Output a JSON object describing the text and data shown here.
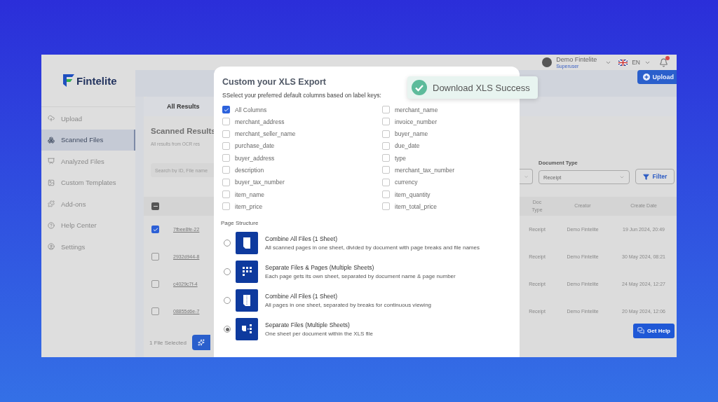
{
  "brand": {
    "name": "Fintelite"
  },
  "sidebar": {
    "items": [
      {
        "label": "Upload",
        "selected": false
      },
      {
        "label": "Scanned Files",
        "selected": true
      },
      {
        "label": "Analyzed Files",
        "selected": false
      },
      {
        "label": "Custom Templates",
        "selected": false
      },
      {
        "label": "Add-ons",
        "selected": false
      },
      {
        "label": "Help Center",
        "selected": false
      },
      {
        "label": "Settings",
        "selected": false
      }
    ]
  },
  "header": {
    "user": {
      "name": "Demo Fintelite",
      "role": "Superuser"
    },
    "language": "EN",
    "upload_button": "Upload"
  },
  "tabs": [
    {
      "label": "All Results",
      "selected": true
    }
  ],
  "page": {
    "title": "Scanned Results",
    "subtitle": "All results from OCR res",
    "search": {
      "placeholder": "Search by ID, File name"
    }
  },
  "filters": {
    "document_type": {
      "label": "Document Type",
      "value": "Receipt"
    },
    "button": "Filter"
  },
  "table": {
    "select_all": {
      "indeterminate": true
    },
    "columns": [
      "Doc Type",
      "Creator",
      "Create Date"
    ],
    "rows": [
      {
        "selected": true,
        "id": "7fbee8fe-22",
        "doc_type": "Receipt",
        "creator": "Demo Fintelite",
        "date": "19 Jun 2024, 20:49"
      },
      {
        "selected": false,
        "id": "2932d944-8",
        "doc_type": "Receipt",
        "creator": "Demo Fintelite",
        "date": "30 May 2024, 08:21"
      },
      {
        "selected": false,
        "id": "c4029c7f-4",
        "doc_type": "Receipt",
        "creator": "Demo Fintelite",
        "date": "24 May 2024, 12:27"
      },
      {
        "selected": false,
        "id": "08855d6e-7",
        "doc_type": "Receipt",
        "creator": "Demo Fintelite",
        "date": "20 May 2024, 12:06"
      }
    ]
  },
  "selection": {
    "count": "1 File Selected"
  },
  "help_button": "Get Help",
  "modal": {
    "title": "Custom your XLS Export",
    "subtitle": "SSelect your preferred default columns based on label keys:",
    "columns": [
      {
        "label": "All Columns",
        "checked": true
      },
      {
        "label": "merchant_name",
        "checked": false
      },
      {
        "label": "merchant_address",
        "checked": false
      },
      {
        "label": "invoice_number",
        "checked": false
      },
      {
        "label": "merchant_seller_name",
        "checked": false
      },
      {
        "label": "buyer_name",
        "checked": false
      },
      {
        "label": "purchase_date",
        "checked": false
      },
      {
        "label": "due_date",
        "checked": false
      },
      {
        "label": "buyer_address",
        "checked": false
      },
      {
        "label": "type",
        "checked": false
      },
      {
        "label": "description",
        "checked": false
      },
      {
        "label": "merchant_tax_number",
        "checked": false
      },
      {
        "label": "buyer_tax_number",
        "checked": false
      },
      {
        "label": "currency",
        "checked": false
      },
      {
        "label": "item_name",
        "checked": false
      },
      {
        "label": "item_quantity",
        "checked": false
      },
      {
        "label": "item_price",
        "checked": false
      },
      {
        "label": "item_total_price",
        "checked": false
      }
    ],
    "structure_title": "Page Structure",
    "options": [
      {
        "title": "Combine All Files (1 Sheet)",
        "description": "All scanned pages in one sheet, divided by document with page breaks and file names",
        "selected": false
      },
      {
        "title": "Separate Files & Pages (Multiple Sheets)",
        "description": "Each page gets its own sheet, separated by document name & page number",
        "selected": false
      },
      {
        "title": "Combine All Files (1 Sheet)",
        "description": "All pages in one sheet, separated by breaks for continuous viewing",
        "selected": false
      },
      {
        "title": "Separate Files (Multiple Sheets)",
        "description": "One sheet per document within the XLS file",
        "selected": true
      }
    ]
  },
  "toast": {
    "message": "Download XLS Success"
  }
}
